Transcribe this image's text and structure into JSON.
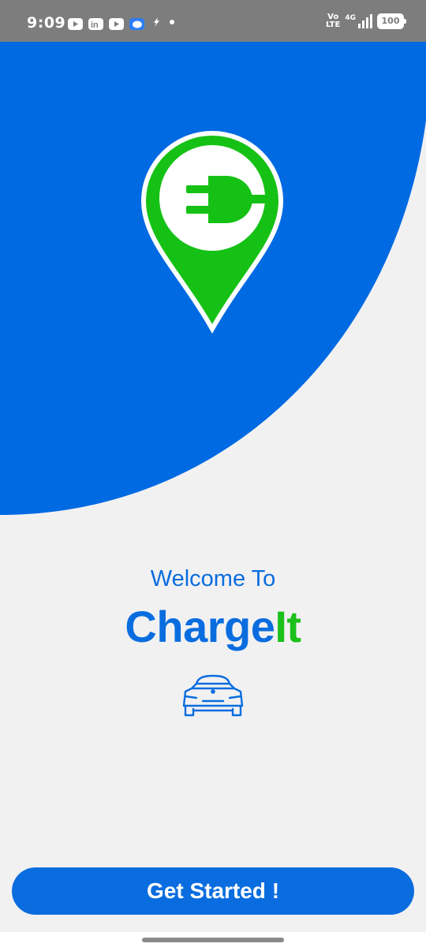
{
  "status_bar": {
    "time": "9:09",
    "network_label_top": "Vo",
    "network_label_bottom": "LTE",
    "signal_label": "4G",
    "battery": "100",
    "notification_icons": [
      "youtube-icon",
      "linkedin-icon",
      "youtube-icon",
      "messenger-icon",
      "bolt-icon",
      "dot-icon"
    ]
  },
  "hero": {
    "logo_icon": "ev-charging-location-pin-icon",
    "colors": {
      "background": "#006ae2",
      "pin": "#16c116"
    }
  },
  "welcome": {
    "line1": "Welcome To",
    "brand_part1": "Charge",
    "brand_part2": "It",
    "car_icon": "car-front-icon"
  },
  "cta": {
    "label": "Get Started !"
  },
  "colors": {
    "primary": "#0a6ddf",
    "accent": "#1bc01b",
    "page": "#f1f1f2"
  }
}
